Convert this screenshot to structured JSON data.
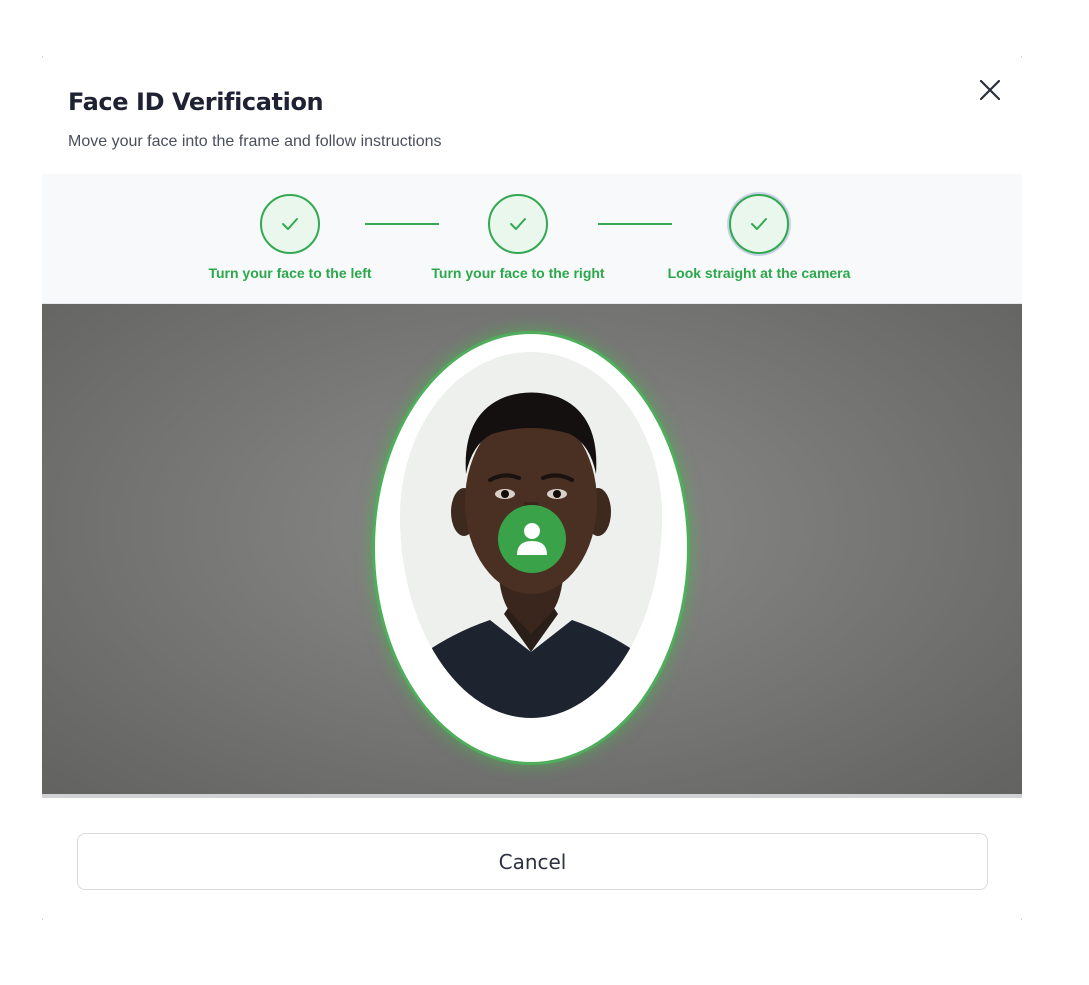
{
  "dialog": {
    "title": "Face ID Verification",
    "subtitle": "Move your face into the frame and follow instructions",
    "close_icon": "close-icon"
  },
  "steps": [
    {
      "label": "Turn your face to the left",
      "status": "complete",
      "icon": "check-icon"
    },
    {
      "label": "Turn your face to the right",
      "status": "complete",
      "icon": "check-icon"
    },
    {
      "label": "Look straight at the camera",
      "status": "complete",
      "icon": "check-icon"
    }
  ],
  "camera": {
    "frame_shape": "oval",
    "status_icon": "user-icon"
  },
  "actions": {
    "cancel_label": "Cancel"
  },
  "colors": {
    "accent": "#34a853",
    "step_bg": "#e9f7ec",
    "title": "#1e2233",
    "badge": "#3aa34a"
  }
}
